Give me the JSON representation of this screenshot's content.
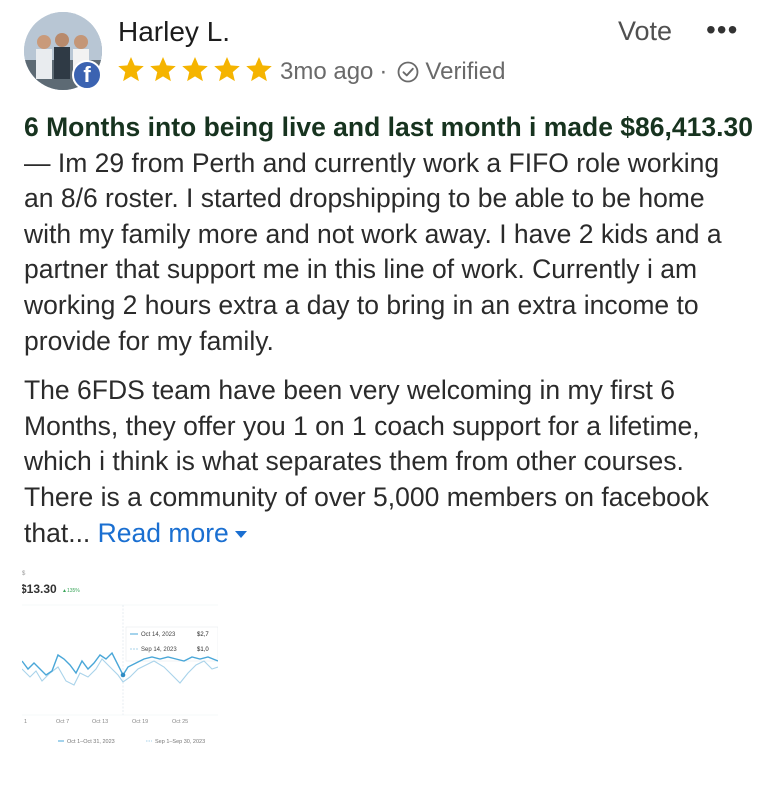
{
  "author": {
    "name": "Harley L.",
    "platform_badge": "f"
  },
  "rating": {
    "stars": 5,
    "max": 5,
    "star_color": "#f5b400"
  },
  "meta": {
    "time_ago": "3mo ago",
    "separator": "·",
    "verified_label": "Verified"
  },
  "actions": {
    "vote_label": "Vote",
    "more_label": "•••"
  },
  "review": {
    "headline": "6 Months into being live and last month i made $86,413.30",
    "body_1": " — Im 29 from Perth and currently work a FIFO role working an 8/6 roster. I started dropshipping to be able to be home with my family more and not work away. I have 2 kids and a partner that support me in this line of work. Currently i am working 2 hours extra a day to bring in an extra income to provide for my family.",
    "body_2": "The 6FDS team have been very welcoming in my first 6 Months, they offer you 1 on 1 coach support for a lifetime, which i think is what separates them from other courses. There is a community of over 5,000 members on facebook that...",
    "read_more_label": "Read more"
  },
  "attachment": {
    "value_text": "$13.30",
    "change_text": "▲135%",
    "tooltip_rows": [
      {
        "date": "Oct 14, 2023",
        "value": "$2,7"
      },
      {
        "date": "Sep 14, 2023",
        "value": "$1,0"
      }
    ],
    "x_ticks": [
      "1",
      "Oct 7",
      "Oct 13",
      "Oct 19",
      "Oct 25"
    ],
    "legend": [
      "Oct 1–Oct 31, 2023",
      "Sep 1–Sep 30, 2023"
    ],
    "colors": {
      "current": "#4aa7d8",
      "previous": "#a9d3ea"
    }
  }
}
